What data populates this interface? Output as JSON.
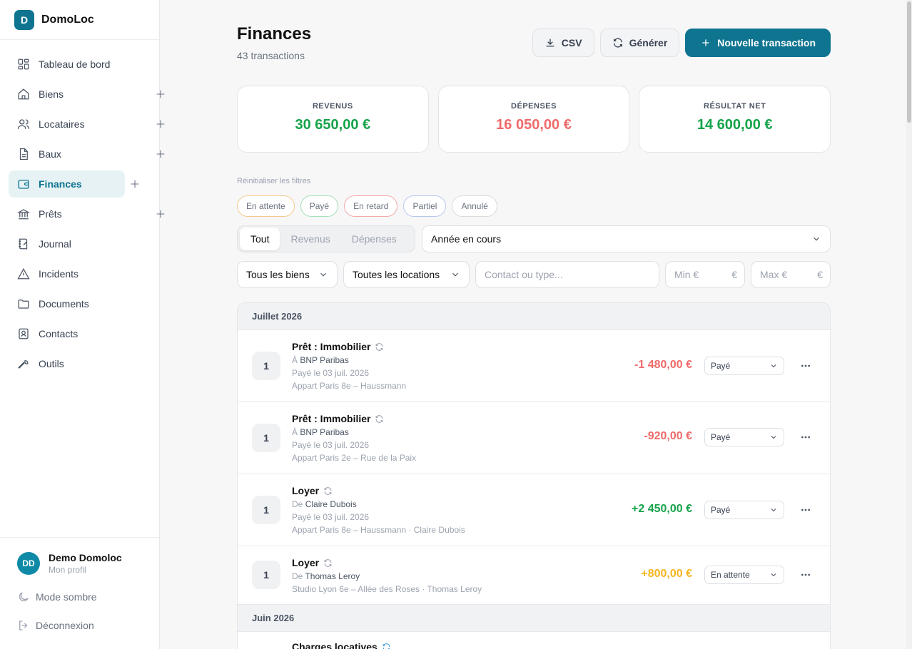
{
  "brand": {
    "logo_letter": "D",
    "name": "DomoLoc"
  },
  "nav": [
    {
      "label": "Tableau de bord",
      "icon": "dashboard-icon",
      "plus": false
    },
    {
      "label": "Biens",
      "icon": "home-icon",
      "plus": true
    },
    {
      "label": "Locataires",
      "icon": "users-icon",
      "plus": true
    },
    {
      "label": "Baux",
      "icon": "file-icon",
      "plus": true
    },
    {
      "label": "Finances",
      "icon": "wallet-icon",
      "plus": true,
      "active": true
    },
    {
      "label": "Prêts",
      "icon": "bank-icon",
      "plus": true
    },
    {
      "label": "Journal",
      "icon": "notebook-icon",
      "plus": false
    },
    {
      "label": "Incidents",
      "icon": "warning-icon",
      "plus": false
    },
    {
      "label": "Documents",
      "icon": "folder-icon",
      "plus": false
    },
    {
      "label": "Contacts",
      "icon": "contact-icon",
      "plus": false
    },
    {
      "label": "Outils",
      "icon": "wrench-icon",
      "plus": false
    }
  ],
  "profile": {
    "initials": "DD",
    "name": "Demo Domoloc",
    "sub": "Mon profil"
  },
  "dark_mode_label": "Mode sombre",
  "logout_label": "Déconnexion",
  "header": {
    "title": "Finances",
    "subtitle": "43 transactions",
    "csv_label": "CSV",
    "generate_label": "Générer",
    "new_label": "Nouvelle transaction"
  },
  "stats": [
    {
      "label": "REVENUS",
      "value": "30 650,00 €",
      "tone": "green"
    },
    {
      "label": "DÉPENSES",
      "value": "16 050,00 €",
      "tone": "red"
    },
    {
      "label": "RÉSULTAT NET",
      "value": "14 600,00 €",
      "tone": "green"
    }
  ],
  "filters": {
    "reset_label": "Réinitialiser les filtres",
    "chips": [
      "En attente",
      "Payé",
      "En retard",
      "Partiel",
      "Annulé"
    ],
    "type_tabs": [
      "Tout",
      "Revenus",
      "Dépenses"
    ],
    "active_tab": "Tout",
    "period": "Année en cours",
    "property": "Tous les biens",
    "rental": "Toutes les locations",
    "contact_placeholder": "Contact ou type...",
    "min_placeholder": "Min €",
    "max_placeholder": "Max €",
    "currency": "€"
  },
  "groups": [
    {
      "month": "Juillet 2026",
      "transactions": [
        {
          "num": "1",
          "title": "Prêt : Immobilier",
          "prefix": "À",
          "who": "BNP Paribas",
          "date": "Payé le 03 juil. 2026",
          "place": "Appart Paris 8e – Haussmann",
          "amount": "-1 480,00 €",
          "tone": "red",
          "status": "Payé"
        },
        {
          "num": "1",
          "title": "Prêt : Immobilier",
          "prefix": "À",
          "who": "BNP Paribas",
          "date": "Payé le 03 juil. 2026",
          "place": "Appart Paris 2e – Rue de la Paix",
          "amount": "-920,00 €",
          "tone": "red",
          "status": "Payé"
        },
        {
          "num": "1",
          "title": "Loyer",
          "prefix": "De",
          "who": "Claire Dubois",
          "date": "Payé le 03 juil. 2026",
          "place": "Appart Paris 8e – Haussmann · Claire Dubois",
          "amount": "+2 450,00 €",
          "tone": "green",
          "status": "Payé"
        },
        {
          "num": "1",
          "title": "Loyer",
          "prefix": "De",
          "who": "Thomas Leroy",
          "date": "",
          "place": "Studio Lyon 6e – Allée des Roses · Thomas Leroy",
          "amount": "+800,00 €",
          "tone": "amber",
          "status": "En attente"
        }
      ]
    },
    {
      "month": "Juin 2026",
      "transactions": [
        {
          "title": "Charges locatives"
        }
      ]
    }
  ]
}
